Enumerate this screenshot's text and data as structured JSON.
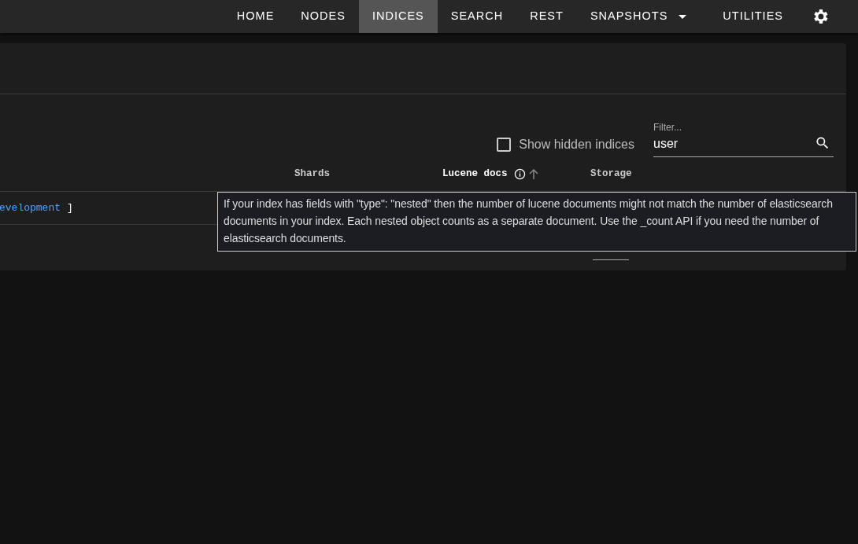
{
  "nav": {
    "items": [
      {
        "label": "HOME",
        "selected": false,
        "kind": "link"
      },
      {
        "label": "NODES",
        "selected": false,
        "kind": "link"
      },
      {
        "label": "INDICES",
        "selected": true,
        "kind": "link"
      },
      {
        "label": "SEARCH",
        "selected": false,
        "kind": "link"
      },
      {
        "label": "REST",
        "selected": false,
        "kind": "link"
      },
      {
        "label": "SNAPSHOTS",
        "selected": false,
        "kind": "dropdown"
      },
      {
        "label": "UTILITIES",
        "selected": false,
        "kind": "link"
      }
    ]
  },
  "toolbar": {
    "show_hidden": {
      "label": "Show hidden indices",
      "checked": false
    },
    "filter": {
      "label": "Filter...",
      "value": "user"
    }
  },
  "table": {
    "columns": [
      {
        "label": "Shards",
        "sorted": false,
        "info": false
      },
      {
        "label": "Lucene docs",
        "sorted": true,
        "info": true
      },
      {
        "label": "Storage",
        "sorted": false,
        "info": false
      }
    ],
    "rows": [
      {
        "name": "evelopment",
        "bracket": "]"
      }
    ]
  },
  "tooltip": {
    "text": "If your index has fields with \"type\": \"nested\" then the number of lucene documents might not match the number of elasticsearch documents in your index. Each nested object counts as a separate document. Use the _count API if you need the number of elasticsearch documents."
  }
}
